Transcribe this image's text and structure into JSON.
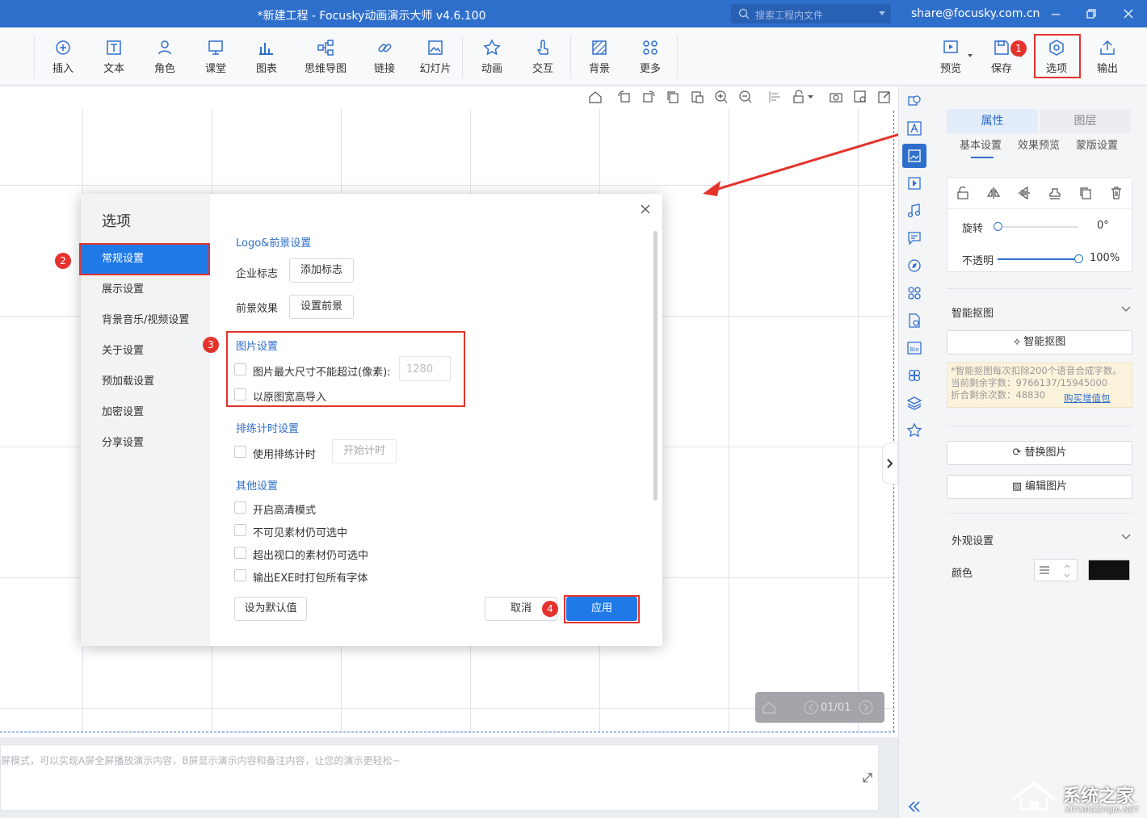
{
  "titlebar": {
    "title": "*新建工程 - Focusky动画演示大师  v4.6.100",
    "search_placeholder": "搜索工程内文件",
    "email": "share@focusky.com.cn"
  },
  "toolbar": {
    "left": [
      {
        "label": "插入",
        "icon": "plus-circle-icon"
      },
      {
        "label": "文本",
        "icon": "text-icon"
      },
      {
        "label": "角色",
        "icon": "person-icon"
      },
      {
        "label": "课堂",
        "icon": "classroom-icon"
      },
      {
        "label": "图表",
        "icon": "chart-icon"
      },
      {
        "label": "思维导图",
        "icon": "mindmap-icon"
      },
      {
        "label": "链接",
        "icon": "link-icon"
      },
      {
        "label": "幻灯片",
        "icon": "slide-icon"
      },
      {
        "label": "动画",
        "icon": "star-icon"
      },
      {
        "label": "交互",
        "icon": "hand-icon"
      },
      {
        "label": "背景",
        "icon": "background-icon"
      },
      {
        "label": "更多",
        "icon": "more-icon"
      }
    ],
    "right": [
      {
        "label": "预览",
        "icon": "preview-icon"
      },
      {
        "label": "保存",
        "icon": "save-icon"
      },
      {
        "label": "选项",
        "icon": "gear-icon"
      },
      {
        "label": "输出",
        "icon": "export-icon"
      }
    ]
  },
  "canvas": {
    "pager": "01/01",
    "notes_hint": "屏模式，可以实现A屏全屏播放演示内容，B屏显示演示内容和备注内容，让您的演示更轻松~"
  },
  "dialog": {
    "title": "选项",
    "nav": [
      "常规设置",
      "展示设置",
      "背景音乐/视频设置",
      "关于设置",
      "预加载设置",
      "加密设置",
      "分享设置"
    ],
    "active_nav": "常规设置",
    "logo_section": "Logo&前景设置",
    "logo_label": "企业标志",
    "logo_button": "添加标志",
    "fg_label": "前景效果",
    "fg_button": "设置前景",
    "image_section": "图片设置",
    "image_max_label": "图片最大尺寸不能超过(像素):",
    "image_max_value": "1280",
    "image_original_label": "以原图宽高导入",
    "rehearse_section": "排练计时设置",
    "rehearse_label": "使用排练计时",
    "rehearse_button": "开始计时",
    "other_section": "其他设置",
    "other_options": [
      "开启高清模式",
      "不可见素材仍可选中",
      "超出视口的素材仍可选中",
      "输出EXE时打包所有字体"
    ],
    "default_button": "设为默认值",
    "cancel_button": "取消",
    "apply_button": "应用"
  },
  "badges": [
    "1",
    "2",
    "3",
    "4"
  ],
  "rpanel": {
    "tabs": [
      "属性",
      "图层"
    ],
    "subtabs": [
      "基本设置",
      "效果预览",
      "蒙版设置"
    ],
    "rotate_label": "旋转",
    "rotate_value": "0°",
    "rotate_fraction": 0,
    "opacity_label": "不透明",
    "opacity_value": "100%",
    "opacity_fraction": 1,
    "smart_cut_title": "智能抠图",
    "smart_cut_button": "智能抠图",
    "smart_cut_note1": "*智能抠图每次扣除200个语音合成字数。",
    "smart_cut_note2": "当前剩余字数：9766137/15945000",
    "smart_cut_note3": "折合剩余次数：48830",
    "buy_link": "购买增值包",
    "replace_button": "替换图片",
    "edit_button": "编辑图片",
    "appearance_title": "外观设置",
    "color_label": "颜色"
  },
  "watermark": {
    "text": "系统之家",
    "sub": "XITONGZHIJIA.NET"
  },
  "colors": {
    "accent": "#2f6fcc",
    "active_nav": "#1f7ae8",
    "annotation": "#e5322d"
  }
}
